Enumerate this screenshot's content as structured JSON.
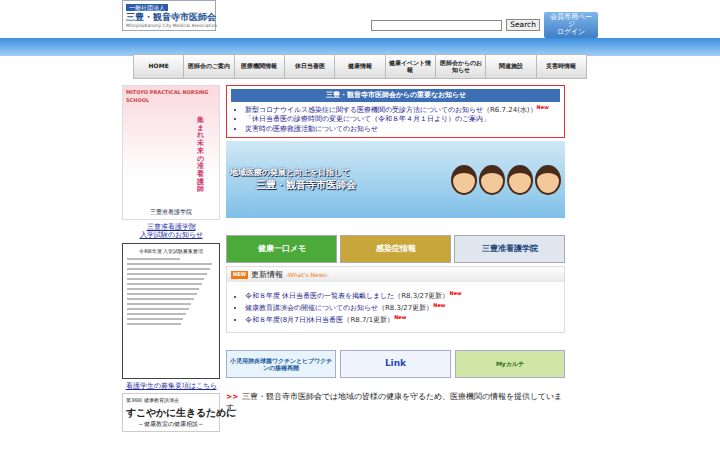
{
  "logo": {
    "tag": "一般社団法人",
    "name": "三豊・観音寺市医師会",
    "en": "Mitoyo&Kanonji City Medical Association"
  },
  "search": {
    "button": "Search"
  },
  "member_login": [
    "会員専用ページ",
    "ログイン"
  ],
  "nav": [
    "HOME",
    "医師会のご案内",
    "医療機関情報",
    "休日当番医",
    "健康情報",
    "健康イベント情報",
    "医師会からのお知らせ",
    "関連施設",
    "災害時情報"
  ],
  "sidebar": {
    "poster": {
      "title": "MITOYO PRACTICAL NURSING SCHOOL",
      "slogan": "集まれ未来の准看護師",
      "caption": "三豊准看護学院"
    },
    "link1": [
      "三豊准看護学院",
      "入学試験のお知らせ"
    ],
    "doc1": {
      "title": "令和8年度 入学試験募集要項"
    },
    "link2": "看護学生の募集要項はこちら",
    "doc2": {
      "pre": "第36回 健康教育講演会",
      "title": "すこやかに生きるために",
      "sub": "～健康教室の健康相談～"
    }
  },
  "notice": {
    "header": "三豊・観音寺市医師会からの重要なお知らせ",
    "items": [
      {
        "text": "新型コロナウイルス感染症に関する医療機関の受診方法についてのお知らせ",
        "date": "（R6.7.24(水)）",
        "new": "New"
      },
      {
        "text": "「休日当番医の診療時間の変更について（令和８年４月１日より）のご案内",
        "date": "」",
        "new": ""
      },
      {
        "text": "災害時の医療救護活動についてのお知らせ",
        "date": "",
        "new": ""
      }
    ]
  },
  "hero": {
    "line1": "地域医療の発展と向上を目指して",
    "line2": "三豊・観音寺市医師会"
  },
  "quick_links": [
    {
      "label": "健康一口メモ",
      "color": "#4caa3a"
    },
    {
      "label": "感染症情報",
      "color": "#c9a63a"
    },
    {
      "label": "三豊准看護学院",
      "color": "#dfe6ef"
    }
  ],
  "updates": {
    "badge": "NEW",
    "title": "更新情報",
    "sub": "-What's News-",
    "items": [
      {
        "text": "令和８年度 休日当番医の一覧表を掲載しました",
        "date": "（R8.3/27更新）",
        "new": "New"
      },
      {
        "text": "健康教育講演会の開催についてのお知らせ",
        "date": "（R8.3/27更新）",
        "new": "New"
      },
      {
        "text": "令和８年度(8月7日)休日当番医",
        "date": "（R8.7/1更新）",
        "new": "New"
      }
    ]
  },
  "ads": [
    "小児用肺炎球菌ワクチンとヒブワクチンの接種再開",
    "Link",
    "Myカルテ"
  ],
  "footer_line": {
    "marker": ">>",
    "text": "三豊・観音寺市医師会では地域の皆様の健康を守るため、医療機関の情報を提供しています。"
  }
}
